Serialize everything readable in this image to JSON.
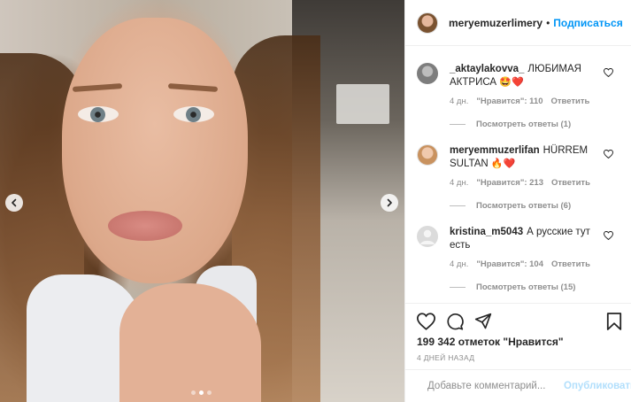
{
  "post": {
    "carousel": {
      "slide_count": 3,
      "active_slide": 2
    }
  },
  "header": {
    "username": "meryemuzerlimery",
    "separator": "•",
    "follow_label": "Подписаться"
  },
  "comments": [
    {
      "username": "_aktaylakovva_",
      "text": "ЛЮБИМАЯ АКТРИСА",
      "emoji": "🤩❤️",
      "time": "4 дн.",
      "likes": "\"Нравится\": 110",
      "reply_label": "Ответить",
      "view_replies": "Посмотреть ответы (1)"
    },
    {
      "username": "meryemmuzerlifan",
      "text": "HÜRREM SULTAN",
      "emoji": "🔥❤️",
      "time": "4 дн.",
      "likes": "\"Нравится\": 213",
      "reply_label": "Ответить",
      "view_replies": "Посмотреть ответы (6)"
    },
    {
      "username": "kristina_m5043",
      "text": "А русские тут есть",
      "emoji": "",
      "time": "4 дн.",
      "likes": "\"Нравится\": 104",
      "reply_label": "Ответить",
      "view_replies": "Посмотреть ответы (15)"
    }
  ],
  "actions": {
    "likes_text": "199 342 отметок \"Нравится\"",
    "timestamp": "4 ДНЕЙ НАЗАД"
  },
  "add_comment": {
    "placeholder": "Добавьте комментарий...",
    "publish_label": "Опубликовать"
  },
  "colors": {
    "accent": "#0095f6",
    "publish_disabled": "#b2dffc",
    "muted": "#8e8e8e",
    "border": "#efefef",
    "heart_red": "#e0245e"
  },
  "icons": [
    "chevron-left-icon",
    "chevron-right-icon",
    "heart-icon",
    "comment-icon",
    "share-icon",
    "bookmark-icon",
    "emoji-icon"
  ]
}
